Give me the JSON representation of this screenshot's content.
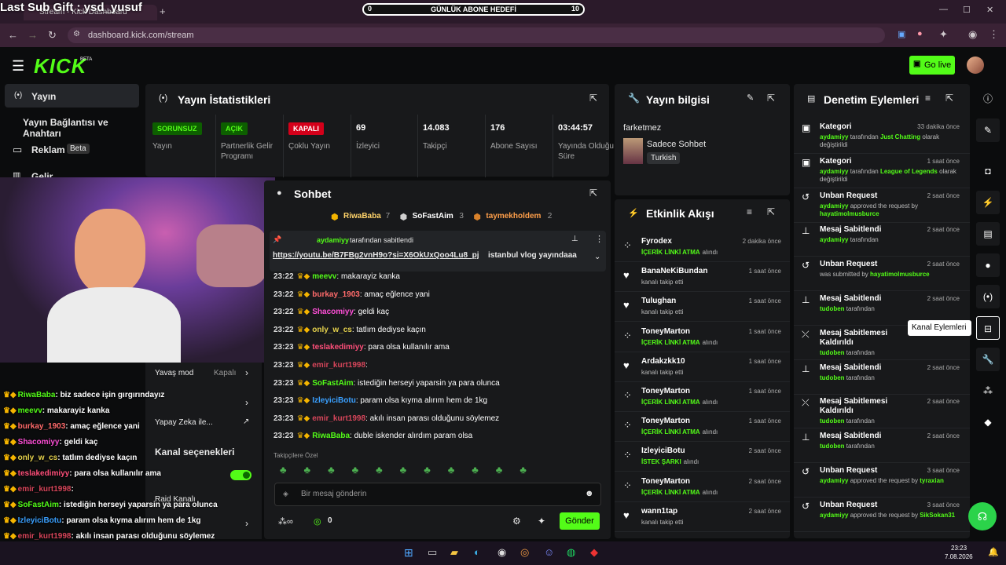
{
  "overlay": {
    "sub_gift": "Last Sub Gift : ysd_yusuf",
    "goal_label": "GÜNLÜK ABONE HEDEFİ",
    "goal_min": "0",
    "goal_max": "10",
    "goal_progress": 0
  },
  "browser": {
    "tab_title": "Stream - Kick Dashboard",
    "url": "dashboard.kick.com/stream"
  },
  "header": {
    "logo": "KICK",
    "logo_beta": "BETA",
    "go_live": "Go live"
  },
  "sidebar": {
    "items": [
      {
        "label": "Yayın"
      },
      {
        "label": "Yayın Bağlantısı ve Anahtarı"
      },
      {
        "label": "Reklam",
        "badge": "Beta"
      },
      {
        "label": "Gelir"
      }
    ]
  },
  "stats": {
    "title": "Yayın İstatistikleri",
    "cards": [
      {
        "value": "SORUNSUZ",
        "label": "Yayın",
        "color": "#53fc18"
      },
      {
        "value": "AÇIK",
        "label": "Partnerlik Gelir Programı",
        "color": "#53fc18"
      },
      {
        "value": "KAPALI",
        "label": "Çoklu Yayın",
        "color": "#ff3b3b"
      },
      {
        "value": "69",
        "label": "İzleyici"
      },
      {
        "value": "14.083",
        "label": "Takipçi"
      },
      {
        "value": "176",
        "label": "Abone Sayısı"
      },
      {
        "value": "03:44:57",
        "label": "Yayında Olduğu Süre"
      }
    ]
  },
  "chat": {
    "title": "Sohbet",
    "top": [
      {
        "name": "RiwaBaba",
        "count": "7"
      },
      {
        "name": "SoFastAim",
        "count": "3"
      },
      {
        "name": "taymekholdem",
        "count": "2"
      }
    ],
    "pinned_by": "aydamiyy",
    "pinned_suffix": "tarafından sabitlendi",
    "pinned_link": "https://youtu.be/B7FBg2vnH9o?si=X6OkUxQoo4Lu8_pj",
    "pinned_text": " istanbul vlog yayındaaa",
    "messages": [
      {
        "time": "23:22",
        "user": "meevv",
        "color": "#53fc18",
        "text": "makarayiz kanka"
      },
      {
        "time": "23:22",
        "user": "burkay_1903",
        "color": "#ff6b6b",
        "text": "amaç eğlence yani"
      },
      {
        "time": "23:22",
        "user": "Shacomiyy",
        "color": "#ff4fd8",
        "text": "geldi kaç"
      },
      {
        "time": "23:22",
        "user": "only_w_cs",
        "color": "#e8d44d",
        "text": "tatlım dediyse kaçın"
      },
      {
        "time": "23:23",
        "user": "teslakedimiyy",
        "color": "#ff4f7a",
        "text": "para olsa kullanılır ama"
      },
      {
        "time": "23:23",
        "user": "emir_kurt1998",
        "color": "#d6455a",
        "text": ""
      },
      {
        "time": "23:23",
        "user": "SoFastAim",
        "color": "#53fc18",
        "text": "istediğin herseyi yaparsin ya para olunca"
      },
      {
        "time": "23:23",
        "user": "IzleyiciBotu",
        "color": "#3aa0ff",
        "text": "param olsa kıyma alırım hem de 1kg"
      },
      {
        "time": "23:23",
        "user": "emir_kurt1998",
        "color": "#d6455a",
        "text": "akılı insan parası olduğunu söylemez"
      },
      {
        "time": "23:23",
        "user": "RiwaBaba",
        "color": "#53fc18",
        "text": "duble iskender alırdım param olsa"
      }
    ],
    "followers_only": "Takipçilere Özel",
    "placeholder": "Bir mesaj gönderin",
    "points": "0",
    "send": "Gönder"
  },
  "chat_menu": {
    "slow_mode": "Yavaş mod",
    "slow_value": "Kapalı",
    "ai": "Yapay Zeka ile...",
    "channel_options": "Kanal seçenekleri",
    "raid": "Raid Kanalı"
  },
  "overlay_chat": [
    {
      "user": "RiwaBaba",
      "color": "#53fc18",
      "text": "biz sadece işin gırgırındayız"
    },
    {
      "user": "meevv",
      "color": "#53fc18",
      "text": "makarayiz kanka"
    },
    {
      "user": "burkay_1903",
      "color": "#ff6b6b",
      "text": "amaç eğlence yani"
    },
    {
      "user": "Shacomiyy",
      "color": "#ff4fd8",
      "text": "geldi kaç"
    },
    {
      "user": "only_w_cs",
      "color": "#e8d44d",
      "text": "tatlım dediyse kaçın"
    },
    {
      "user": "teslakedimiyy",
      "color": "#ff4f7a",
      "text": "para olsa kullanılır ama"
    },
    {
      "user": "emir_kurt1998",
      "color": "#d6455a",
      "text": ""
    },
    {
      "user": "SoFastAim",
      "color": "#53fc18",
      "text": "istediğin herseyi yaparsin ya para olunca"
    },
    {
      "user": "IzleyiciBotu",
      "color": "#3aa0ff",
      "text": "param olsa kıyma alırım hem de 1kg"
    },
    {
      "user": "emir_kurt1998",
      "color": "#d6455a",
      "text": "akılı insan parası olduğunu söylemez"
    },
    {
      "user": "RiwaBaba",
      "color": "#53fc18",
      "text": "duble iskender alırdım param olsa"
    }
  ],
  "stream_info": {
    "title": "Yayın bilgisi",
    "stream_title": "farketmez",
    "category": "Sadece Sohbet",
    "tag": "Turkish"
  },
  "events": {
    "title": "Etkinlik Akışı",
    "items": [
      {
        "name": "Fyrodex",
        "time": "2 dakika önce",
        "action": "İÇERİK LİNKİ ATMA",
        "suffix": "alındı",
        "icon": "redeem"
      },
      {
        "name": "BanaNeKiBundan",
        "time": "1 saat önce",
        "action": "",
        "suffix": "kanalı takip etti",
        "icon": "follow"
      },
      {
        "name": "Tulughan",
        "time": "1 saat önce",
        "action": "",
        "suffix": "kanalı takip etti",
        "icon": "follow"
      },
      {
        "name": "ToneyMarton",
        "time": "1 saat önce",
        "action": "İÇERİK LİNKİ ATMA",
        "suffix": "alındı",
        "icon": "redeem"
      },
      {
        "name": "Ardakzkk10",
        "time": "1 saat önce",
        "action": "",
        "suffix": "kanalı takip etti",
        "icon": "follow"
      },
      {
        "name": "ToneyMarton",
        "time": "1 saat önce",
        "action": "İÇERİK LİNKİ ATMA",
        "suffix": "alındı",
        "icon": "redeem"
      },
      {
        "name": "ToneyMarton",
        "time": "1 saat önce",
        "action": "İÇERİK LİNKİ ATMA",
        "suffix": "alındı",
        "icon": "redeem"
      },
      {
        "name": "IzleyiciBotu",
        "time": "2 saat önce",
        "action": "İSTEK ŞARKI",
        "suffix": "alındı",
        "icon": "redeem"
      },
      {
        "name": "ToneyMarton",
        "time": "2 saat önce",
        "action": "İÇERİK LİNKİ ATMA",
        "suffix": "alındı",
        "icon": "redeem"
      },
      {
        "name": "wann1tap",
        "time": "2 saat önce",
        "action": "",
        "suffix": "kanalı takip etti",
        "icon": "follow"
      }
    ]
  },
  "moderation": {
    "title": "Denetim Eylemleri",
    "items": [
      {
        "title": "Kategori",
        "time": "33 dakika önce",
        "actor": "aydamiyy",
        "mid": "tarafından",
        "obj": "Just Chatting",
        "end": "olarak değiştirildi",
        "icon": "category"
      },
      {
        "title": "Kategori",
        "time": "1 saat önce",
        "actor": "aydamiyy",
        "mid": "tarafından",
        "obj": "League of Legends",
        "end": "olarak değiştirildi",
        "icon": "category"
      },
      {
        "title": "Unban Request",
        "time": "2 saat önce",
        "actor": "aydamiyy",
        "mid": "approved the request by",
        "obj": "hayatimolmusburce",
        "end": "",
        "icon": "unban"
      },
      {
        "title": "Mesaj Sabitlendi",
        "time": "2 saat önce",
        "actor": "aydamiyy",
        "mid": "tarafından",
        "obj": "",
        "end": "",
        "icon": "pin"
      },
      {
        "title": "Unban Request",
        "time": "2 saat önce",
        "actor": "",
        "mid": "was submitted by",
        "obj": "hayatimolmusburce",
        "end": "",
        "icon": "unban"
      },
      {
        "title": "Mesaj Sabitlendi",
        "time": "2 saat önce",
        "actor": "tudoben",
        "mid": "tarafından",
        "obj": "",
        "end": "",
        "icon": "pin"
      },
      {
        "title": "Mesaj Sabitlemesi Kaldırıldı",
        "time": "önce",
        "actor": "tudoben",
        "mid": "tarafından",
        "obj": "",
        "end": "",
        "icon": "unpin"
      },
      {
        "title": "Mesaj Sabitlendi",
        "time": "2 saat önce",
        "actor": "tudoben",
        "mid": "tarafından",
        "obj": "",
        "end": "",
        "icon": "pin"
      },
      {
        "title": "Mesaj Sabitlemesi Kaldırıldı",
        "time": "2 saat önce",
        "actor": "tudoben",
        "mid": "tarafından",
        "obj": "",
        "end": "",
        "icon": "unpin"
      },
      {
        "title": "Mesaj Sabitlendi",
        "time": "2 saat önce",
        "actor": "tudoben",
        "mid": "tarafından",
        "obj": "",
        "end": "",
        "icon": "pin"
      },
      {
        "title": "Unban Request",
        "time": "3 saat önce",
        "actor": "aydamiyy",
        "mid": "approved the request by",
        "obj": "tyraxian",
        "end": "",
        "icon": "unban"
      },
      {
        "title": "Unban Request",
        "time": "3 saat önce",
        "actor": "aydamiyy",
        "mid": "approved the request by",
        "obj": "SikSokan31",
        "end": "",
        "icon": "unban"
      }
    ]
  },
  "tooltip": {
    "channel_actions": "Kanal Eylemleri"
  },
  "taskbar": {
    "time": "23:23",
    "date": "7.08.2026"
  },
  "colors": {
    "accent": "#53fc18",
    "panel": "#18191b",
    "bg": "#0b0c0d"
  }
}
